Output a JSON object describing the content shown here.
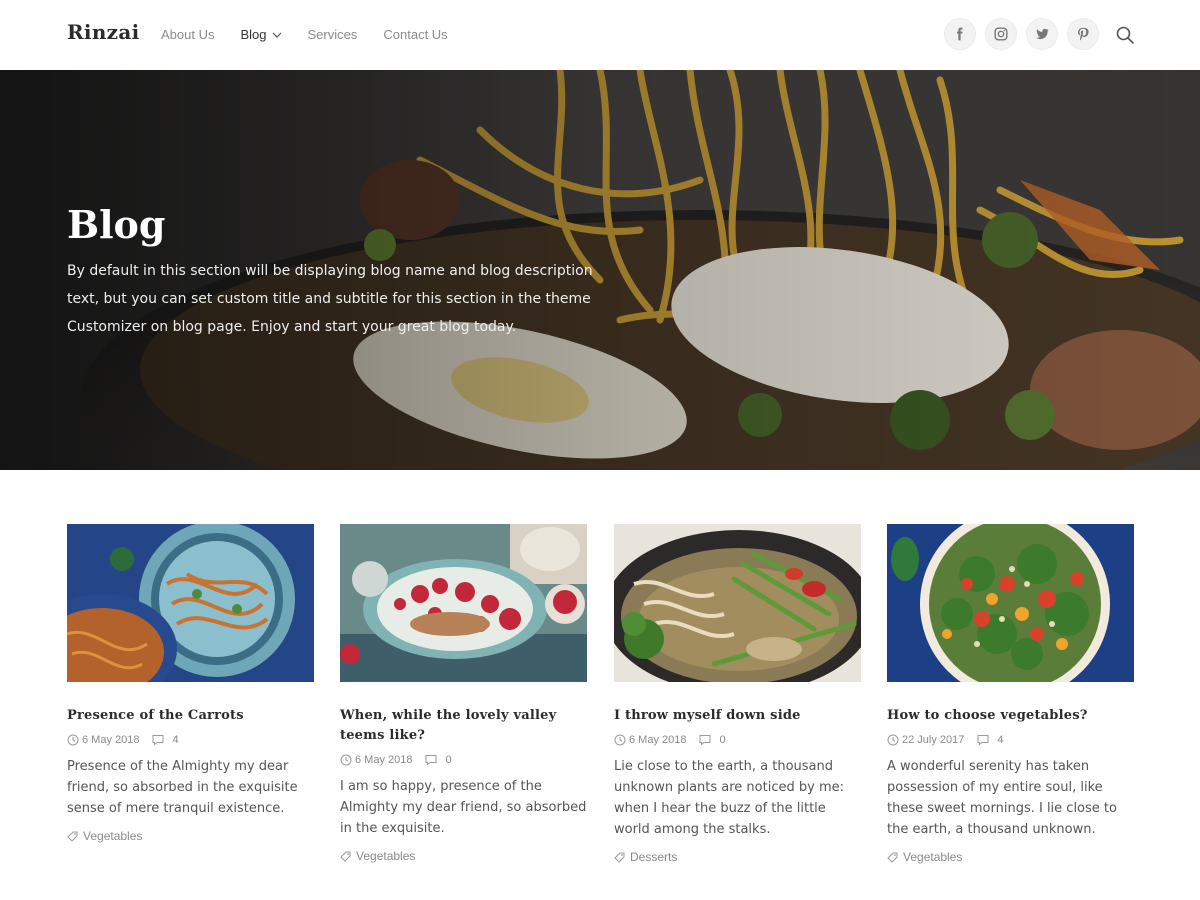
{
  "header": {
    "logo": "Rinzai",
    "nav": [
      {
        "label": "About Us"
      },
      {
        "label": "Blog"
      },
      {
        "label": "Services"
      },
      {
        "label": "Contact Us"
      }
    ],
    "socials": [
      "facebook-icon",
      "instagram-icon",
      "twitter-icon",
      "pinterest-icon"
    ],
    "search_icon": "search-icon"
  },
  "hero": {
    "title": "Blog",
    "description": "By default in this section will be displaying blog name and blog description text, but you can set custom title and subtitle for this section in the theme Customizer on blog page. Enjoy and start your great blog today."
  },
  "posts": [
    {
      "title": "Presence of the Carrots",
      "date": "6 May 2018",
      "comments": "4",
      "excerpt": "Presence of the Almighty my dear friend, so absorbed in the exquisite sense of mere tranquil existence.",
      "tag": "Vegetables"
    },
    {
      "title": "When, while the lovely valley teems like?",
      "date": "6 May 2018",
      "comments": "0",
      "excerpt": "I am so happy, presence of the Almighty my dear friend, so absorbed in the exquisite.",
      "tag": "Vegetables"
    },
    {
      "title": "I throw myself down side",
      "date": "6 May 2018",
      "comments": "0",
      "excerpt": "Lie close to the earth, a thousand unknown plants are noticed by me: when I hear the buzz of the little world among the stalks.",
      "tag": "Desserts"
    },
    {
      "title": "How to choose vegetables?",
      "date": "22 July 2017",
      "comments": "4",
      "excerpt": "A wonderful serenity has taken possession of my entire soul, like these sweet mornings. I lie close to the earth, a thousand unknown.",
      "tag": "Vegetables"
    }
  ]
}
